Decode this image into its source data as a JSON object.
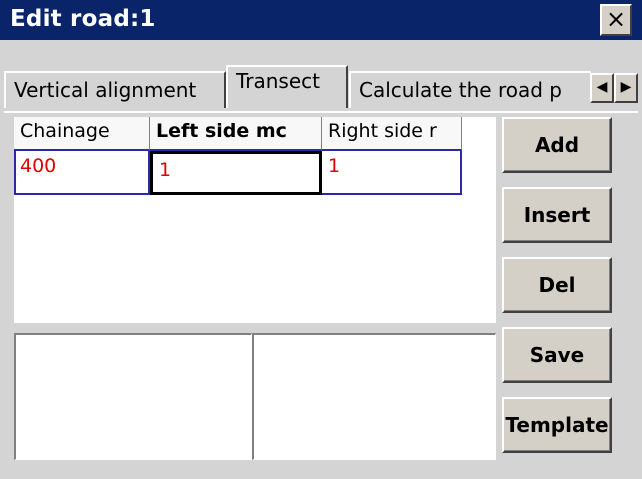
{
  "window": {
    "title": "Edit road:1",
    "close_label": "×"
  },
  "tabs": [
    {
      "label": "Vertical alignment"
    },
    {
      "label": "Transect",
      "active": true
    },
    {
      "label": "Calculate the road p"
    }
  ],
  "tab_scroll": {
    "left": "◀",
    "right": "▶"
  },
  "grid": {
    "headers": [
      "Chainage",
      "Left side mc",
      "Right side r"
    ],
    "rows": [
      [
        "400",
        "1",
        "1"
      ]
    ]
  },
  "buttons": {
    "add": "Add",
    "insert": "Insert",
    "del": "Del",
    "save": "Save",
    "template": "Template"
  },
  "colors": {
    "titlebar": "#0a246a",
    "cell_value": "#e00000",
    "grid_border": "#2a2aa8"
  }
}
